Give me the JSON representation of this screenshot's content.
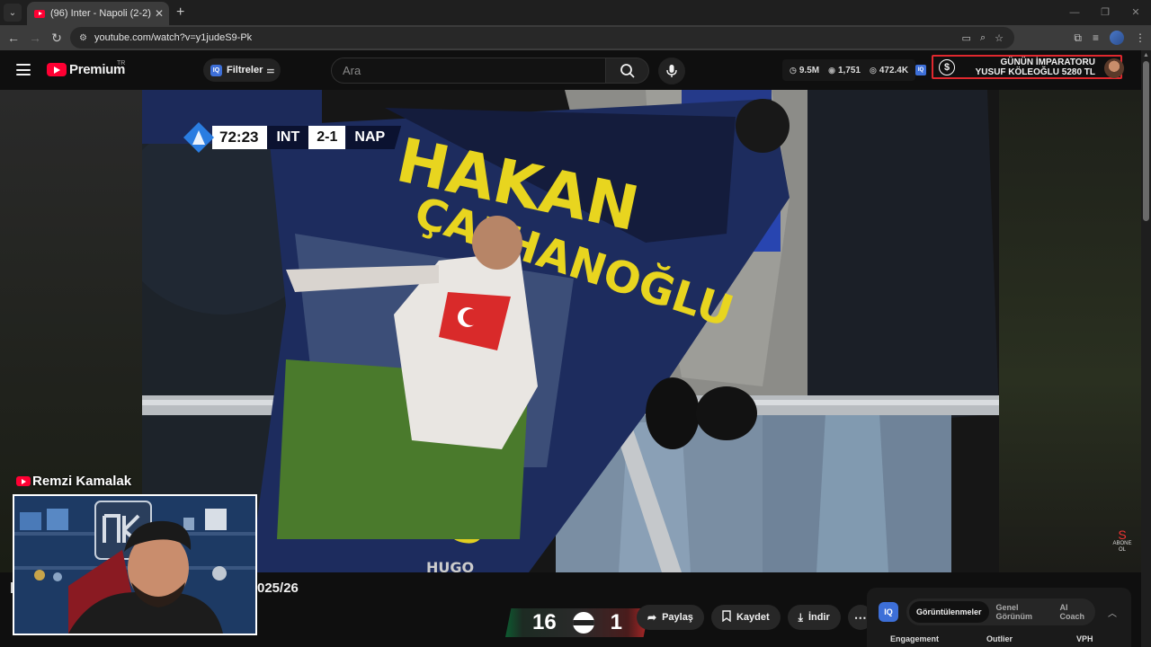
{
  "browser": {
    "tab_title": "(96) Inter - Napoli (2-2) - Maç Ö",
    "url": "youtube.com/watch?v=y1judeS9-Pk"
  },
  "youtube": {
    "logo_text": "Premium",
    "logo_country": "TR",
    "filters_label": "Filtreler",
    "search_placeholder": "Ara"
  },
  "channel_stats": {
    "views": "9.5M",
    "count": "1,751",
    "watch": "472.4K"
  },
  "donation": {
    "line1": "GÜNÜN İMPARATORU",
    "line2": "YUSUF KÖLEOĞLU 5280 TL"
  },
  "scorebug": {
    "time": "72:23",
    "home": "INT",
    "score": "2-1",
    "away": "NAP"
  },
  "watermark": {
    "line1": "ABONE",
    "line2": "OL"
  },
  "video": {
    "title_fragment": "025/26"
  },
  "actions": {
    "share": "Paylaş",
    "save": "Kaydet",
    "download": "İndir"
  },
  "score_overlay": {
    "left": "16",
    "right": "1"
  },
  "streamer": {
    "name": "Remzi Kamalak"
  },
  "iq_panel": {
    "tabs": [
      "Görüntülenmeler",
      "Genel Görünüm",
      "AI Coach"
    ],
    "columns": [
      "Engagement",
      "Outlier",
      "VPH"
    ]
  },
  "colors": {
    "yt_red": "#ff0033",
    "iq_blue": "#3d6fd8",
    "donation_border": "#e0282e",
    "serie_a_blue": "#2a7de1"
  }
}
